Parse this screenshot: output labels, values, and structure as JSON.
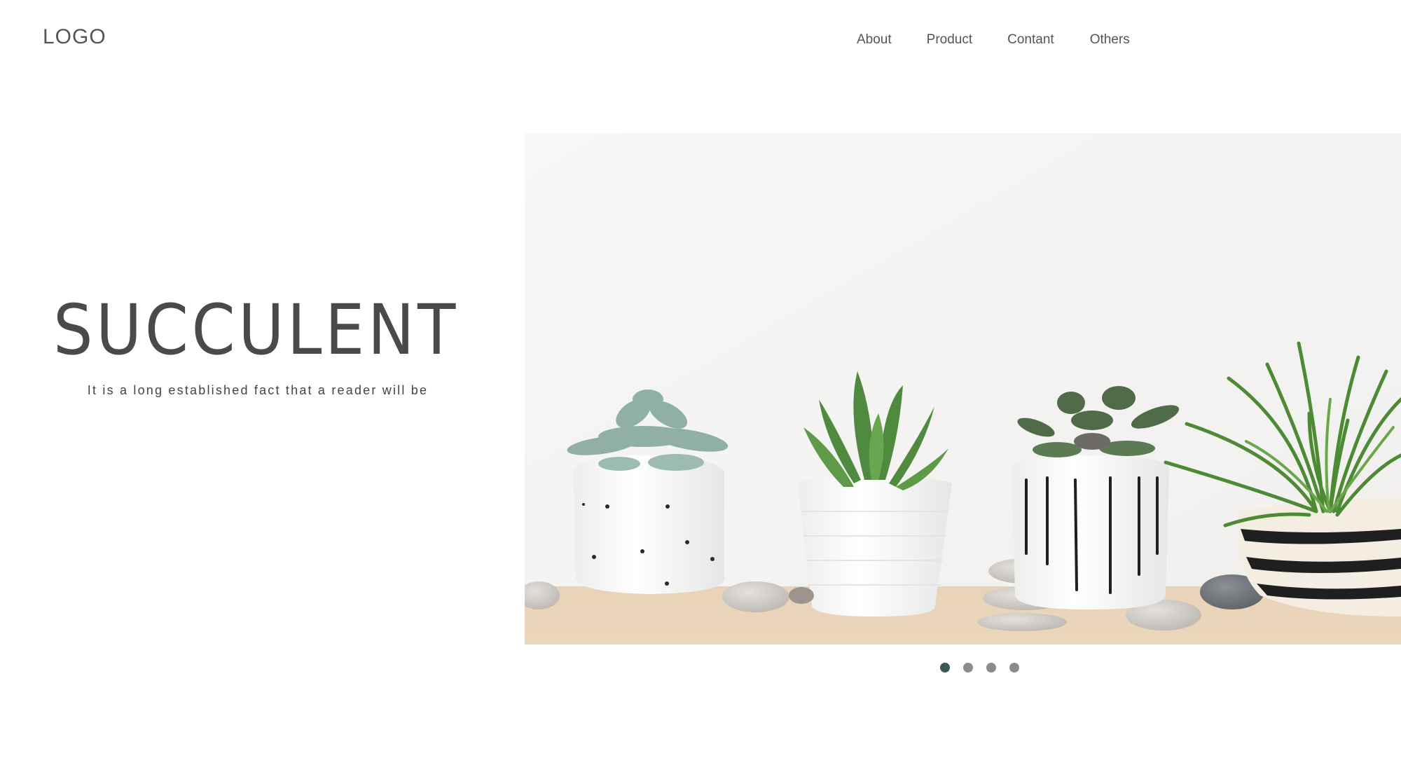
{
  "header": {
    "logo": "LOGO",
    "nav": [
      {
        "label": "About"
      },
      {
        "label": "Product"
      },
      {
        "label": "Contant"
      },
      {
        "label": "Others"
      }
    ]
  },
  "hero": {
    "title": "SUCCULENT",
    "subtitle": "It is a long established fact that a reader will be",
    "image": {
      "subject": "potted succulent plants on a wooden shelf",
      "icon": "photo-image"
    }
  },
  "carousel": {
    "slide_count": 4,
    "active_index": 0,
    "colors": {
      "active": "#3f5658",
      "inactive": "#8c8c8c"
    }
  }
}
